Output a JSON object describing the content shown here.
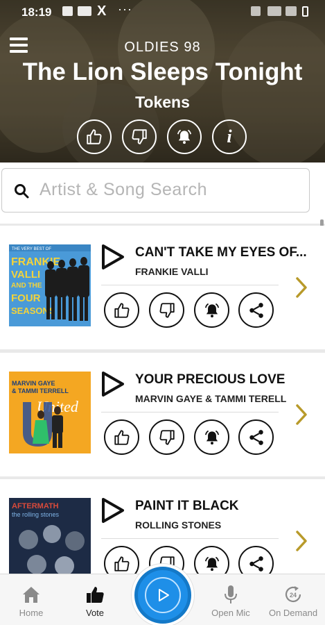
{
  "status_bar": {
    "time": "18:19",
    "x_label": "X",
    "overflow_dots": "···"
  },
  "now_playing": {
    "station": "OLDIES 98",
    "title": "The Lion Sleeps Tonight",
    "artist": "Tokens",
    "info_label": "i"
  },
  "search": {
    "placeholder": "Artist & Song Search"
  },
  "songs": [
    {
      "title": "CAN'T TAKE MY EYES OF...",
      "artist": "FRANKIE VALLI",
      "cover_text": [
        "THE VERY BEST OF",
        "FRANKIE",
        "VALLI",
        "AND THE",
        "FOUR",
        "SEASONS"
      ]
    },
    {
      "title": "YOUR PRECIOUS LOVE",
      "artist": "MARVIN GAYE & TAMMI TERELL",
      "cover_text": [
        "MARVIN GAYE",
        "& TAMMI TERRELL",
        "United"
      ]
    },
    {
      "title": "PAINT IT BLACK",
      "artist": "ROLLING STONES",
      "cover_text": [
        "AFTERMATH",
        "the rolling stones"
      ]
    }
  ],
  "song_actions": [
    "thumbs-up-icon",
    "thumbs-down-icon",
    "alarm-bell-icon",
    "share-icon"
  ],
  "nav": {
    "home": "Home",
    "vote": "Vote",
    "open_mic": "Open Mic",
    "on_demand": "On Demand",
    "on_demand_badge": "24"
  },
  "colors": {
    "accent": "#1e8fe8",
    "chevron": "#b89a2a",
    "header_bg": "#5a5039"
  }
}
